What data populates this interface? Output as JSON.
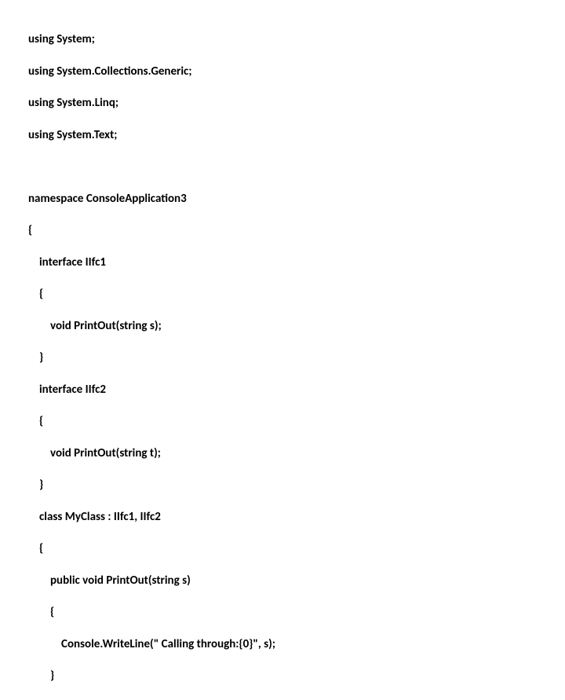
{
  "lines": {
    "l0": "using System;",
    "l1": "using System.Collections.Generic;",
    "l2": "using System.Linq;",
    "l3": "using System.Text;",
    "l4": "namespace ConsoleApplication3",
    "l5": "{",
    "l6": "interface IIfc1",
    "l7": "{",
    "l8": "void PrintOut(string s);",
    "l9": "}",
    "l10": "interface IIfc2",
    "l11": "{",
    "l12": "void PrintOut(string t);",
    "l13": "}",
    "l14": "class MyClass : IIfc1, IIfc2",
    "l15": "{",
    "l16": "public void PrintOut(string s)",
    "l17": "{",
    "l18": "Console.WriteLine(\" Calling through:{0}\", s);",
    "l19": "}"
  }
}
